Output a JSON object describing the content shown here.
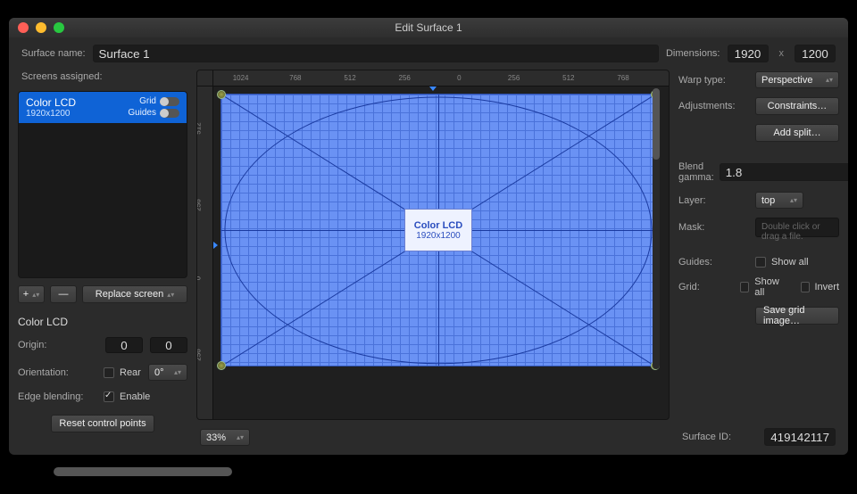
{
  "window": {
    "title": "Edit Surface 1"
  },
  "top": {
    "surface_name_label": "Surface name:",
    "surface_name": "Surface 1",
    "dimensions_label": "Dimensions:",
    "dim_w": "1920",
    "dim_h": "1200",
    "x": "x"
  },
  "left": {
    "screens_label": "Screens assigned:",
    "screen": {
      "name": "Color LCD",
      "res": "1920x1200",
      "grid_label": "Grid",
      "guides_label": "Guides"
    },
    "add": "+",
    "remove": "—",
    "replace": "Replace screen",
    "panel_title": "Color LCD",
    "origin_label": "Origin:",
    "origin_x": "0",
    "origin_y": "0",
    "orientation_label": "Orientation:",
    "rear_label": "Rear",
    "angle": "0°",
    "edge_label": "Edge blending:",
    "enable_label": "Enable",
    "reset": "Reset control points"
  },
  "center": {
    "chip_title": "Color LCD",
    "chip_sub": "1920x1200",
    "zoom": "33%",
    "ticks_top": [
      "1024",
      "768",
      "512",
      "256",
      "0",
      "256",
      "512",
      "768"
    ],
    "ticks_left": [
      "512",
      "256",
      "0",
      "256"
    ]
  },
  "right": {
    "warp_label": "Warp type:",
    "warp_value": "Perspective",
    "adjust_label": "Adjustments:",
    "constraints": "Constraints…",
    "addsplit": "Add split…",
    "gamma_label": "Blend gamma:",
    "gamma": "1.8",
    "layer_label": "Layer:",
    "layer": "top",
    "mask_label": "Mask:",
    "mask_placeholder": "Double click or drag a file.",
    "guides_label": "Guides:",
    "showall": "Show all",
    "grid_label": "Grid:",
    "invert": "Invert",
    "savegrid": "Save grid image…",
    "surfaceid_label": "Surface ID:",
    "surfaceid": "419142117"
  }
}
